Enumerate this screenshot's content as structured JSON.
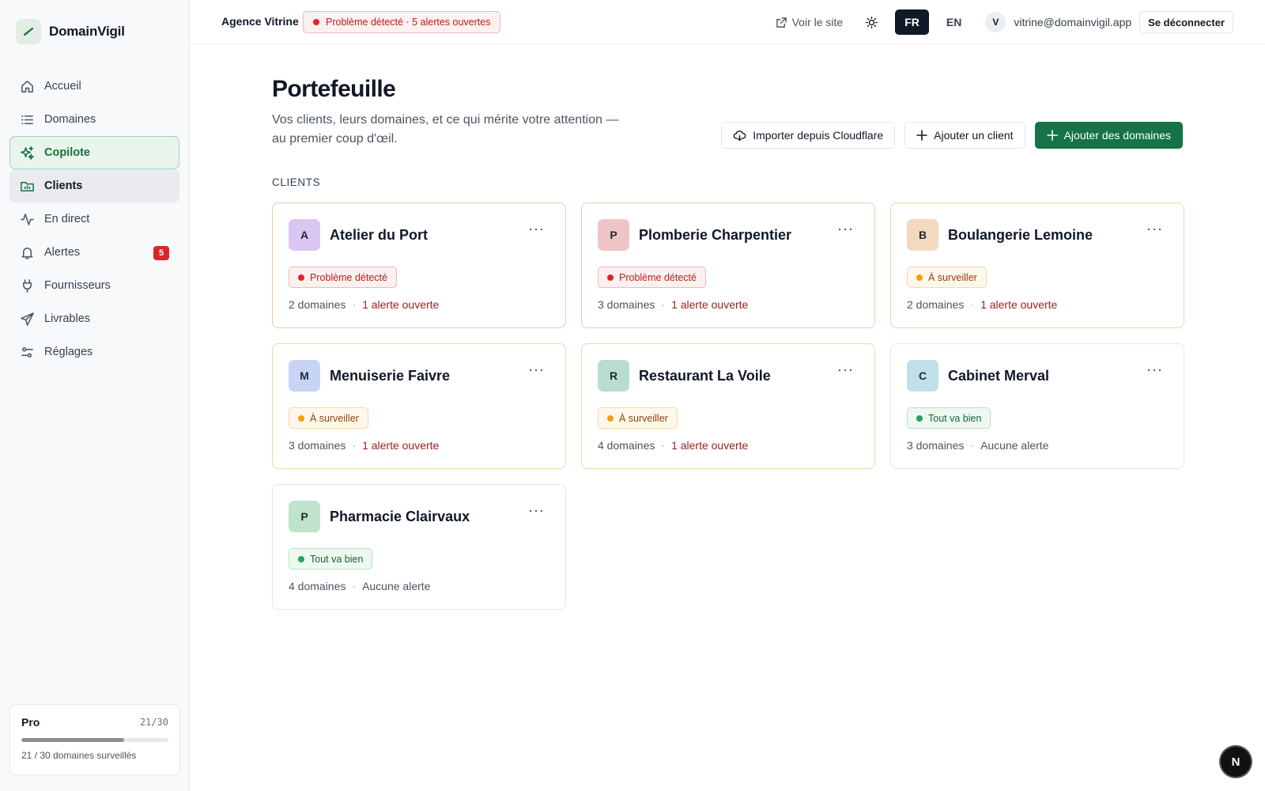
{
  "app": {
    "name": "DomainVigil"
  },
  "sidebar": {
    "items": [
      {
        "label": "Accueil",
        "icon": "home-icon"
      },
      {
        "label": "Domaines",
        "icon": "list-icon"
      },
      {
        "label": "Copilote",
        "icon": "sparkle-icon"
      },
      {
        "label": "Clients",
        "icon": "folder-chart-icon"
      },
      {
        "label": "En direct",
        "icon": "pulse-icon"
      },
      {
        "label": "Alertes",
        "icon": "bell-icon",
        "badge": "5"
      },
      {
        "label": "Fournisseurs",
        "icon": "plug-icon"
      },
      {
        "label": "Livrables",
        "icon": "send-icon"
      },
      {
        "label": "Réglages",
        "icon": "sliders-icon"
      }
    ],
    "plan": {
      "name": "Pro",
      "count": "21/30",
      "used_fraction": 0.7,
      "summary": "21 / 30 domaines surveillés"
    }
  },
  "topbar": {
    "agency": "Agence Vitrine",
    "status": "Problème détecté · 5 alertes ouvertes",
    "site_link": "Voir le site",
    "lang_fr": "FR",
    "lang_en": "EN",
    "avatar": "V",
    "email": "vitrine@domainvigil.app",
    "logout": "Se déconnecter"
  },
  "main": {
    "title": "Portefeuille",
    "subtitle": "Vos clients, leurs domaines, et ce qui mérite votre attention — au premier coup d'œil.",
    "actions": {
      "import": "Importer depuis Cloudflare",
      "add_client": "Ajouter un client",
      "add_domains": "Ajouter des domaines"
    },
    "section_label": "CLIENTS",
    "clients": [
      {
        "initial": "A",
        "name": "Atelier du Port",
        "status": "Problème détecté",
        "domains": "2 domaines",
        "alerts": "1 alerte ouverte"
      },
      {
        "initial": "P",
        "name": "Plomberie Charpentier",
        "status": "Problème détecté",
        "domains": "3 domaines",
        "alerts": "1 alerte ouverte"
      },
      {
        "initial": "B",
        "name": "Boulangerie Lemoine",
        "status": "À surveiller",
        "domains": "2 domaines",
        "alerts": "1 alerte ouverte"
      },
      {
        "initial": "M",
        "name": "Menuiserie Faivre",
        "status": "À surveiller",
        "domains": "3 domaines",
        "alerts": "1 alerte ouverte"
      },
      {
        "initial": "R",
        "name": "Restaurant La Voile",
        "status": "À surveiller",
        "domains": "4 domaines",
        "alerts": "1 alerte ouverte"
      },
      {
        "initial": "C",
        "name": "Cabinet Merval",
        "status": "Tout va bien",
        "domains": "3 domaines",
        "alerts": "Aucune alerte"
      },
      {
        "initial": "P",
        "name": "Pharmacie Clairvaux",
        "status": "Tout va bien",
        "domains": "4 domaines",
        "alerts": "Aucune alerte"
      }
    ]
  },
  "fab": {
    "label": "N"
  },
  "colors": {
    "accent": "#157347",
    "problem": "#dc2626",
    "watch": "#f59e0b",
    "ok": "#22a45d",
    "avatar_a": "#d9c7f2",
    "avatar_p": "#f0c4c7",
    "avatar_b": "#f3d9bf",
    "avatar_m": "#c8d4f5",
    "avatar_r": "#b9ddd0",
    "avatar_c": "#bfe0ea",
    "avatar_p2": "#bfe3cc"
  }
}
